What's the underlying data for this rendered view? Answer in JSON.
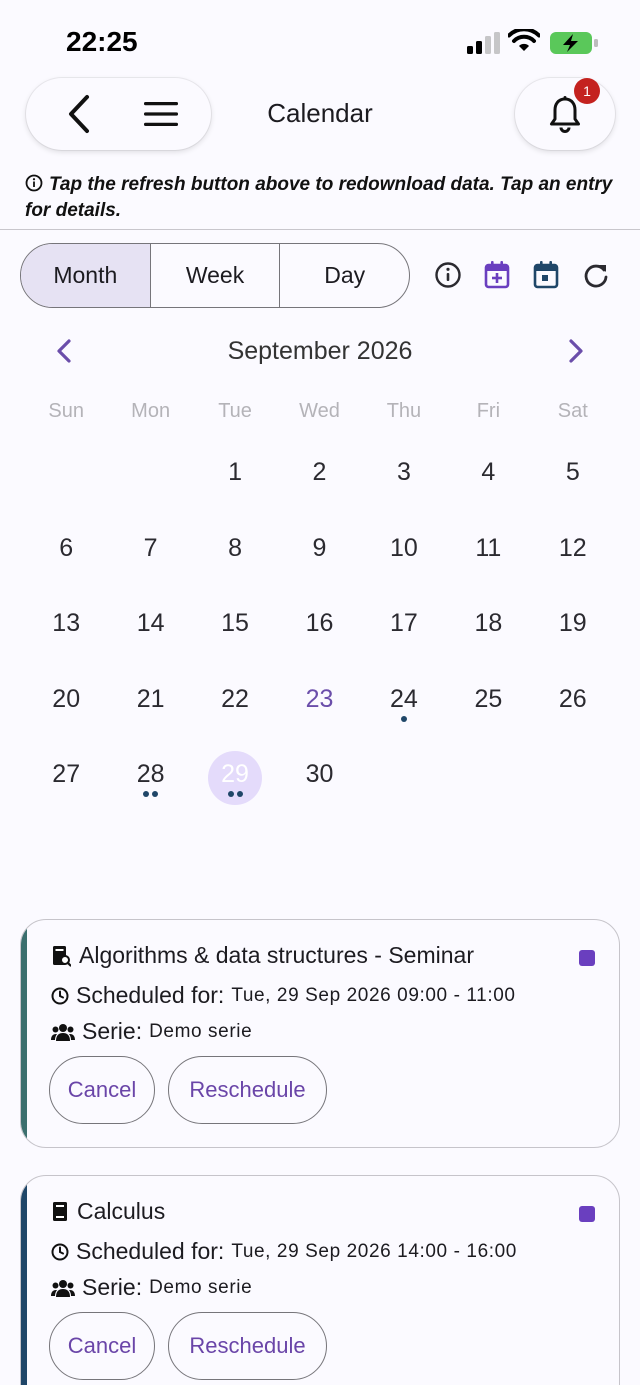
{
  "status_bar": {
    "time": "22:25"
  },
  "header": {
    "title": "Calendar",
    "notification_count": "1"
  },
  "hint": "Tap the refresh button above to redownload data. Tap an entry for details.",
  "view_toggle": {
    "month": "Month",
    "week": "Week",
    "day": "Day",
    "selected": "Month"
  },
  "calendar": {
    "month_label": "September 2026",
    "weekdays": [
      "Sun",
      "Mon",
      "Tue",
      "Wed",
      "Thu",
      "Fri",
      "Sat"
    ],
    "leading_blank_days": 2,
    "days": [
      "1",
      "2",
      "3",
      "4",
      "5",
      "6",
      "7",
      "8",
      "9",
      "10",
      "11",
      "12",
      "13",
      "14",
      "15",
      "16",
      "17",
      "18",
      "19",
      "20",
      "21",
      "22",
      "23",
      "24",
      "25",
      "26",
      "27",
      "28",
      "29",
      "30"
    ],
    "today": "23",
    "selected": "29",
    "event_dot_counts": {
      "24": 1,
      "28": 2,
      "29": 2
    },
    "dot_color": "#1f4668",
    "accent": "#6b4eaa"
  },
  "events": [
    {
      "title": "Algorithms & data structures - Seminar",
      "scheduled_label": "Scheduled for:",
      "scheduled_value": "Tue, 29 Sep 2026 09:00 - 11:00",
      "serie_label": "Serie:",
      "serie_value": "Demo serie",
      "stripe_color": "#3b6f6e",
      "cancel_label": "Cancel",
      "reschedule_label": "Reschedule"
    },
    {
      "title": "Calculus",
      "scheduled_label": "Scheduled for:",
      "scheduled_value": "Tue, 29 Sep 2026 14:00 - 16:00",
      "serie_label": "Serie:",
      "serie_value": "Demo serie",
      "stripe_color": "#1f4668",
      "cancel_label": "Cancel",
      "reschedule_label": "Reschedule"
    }
  ]
}
